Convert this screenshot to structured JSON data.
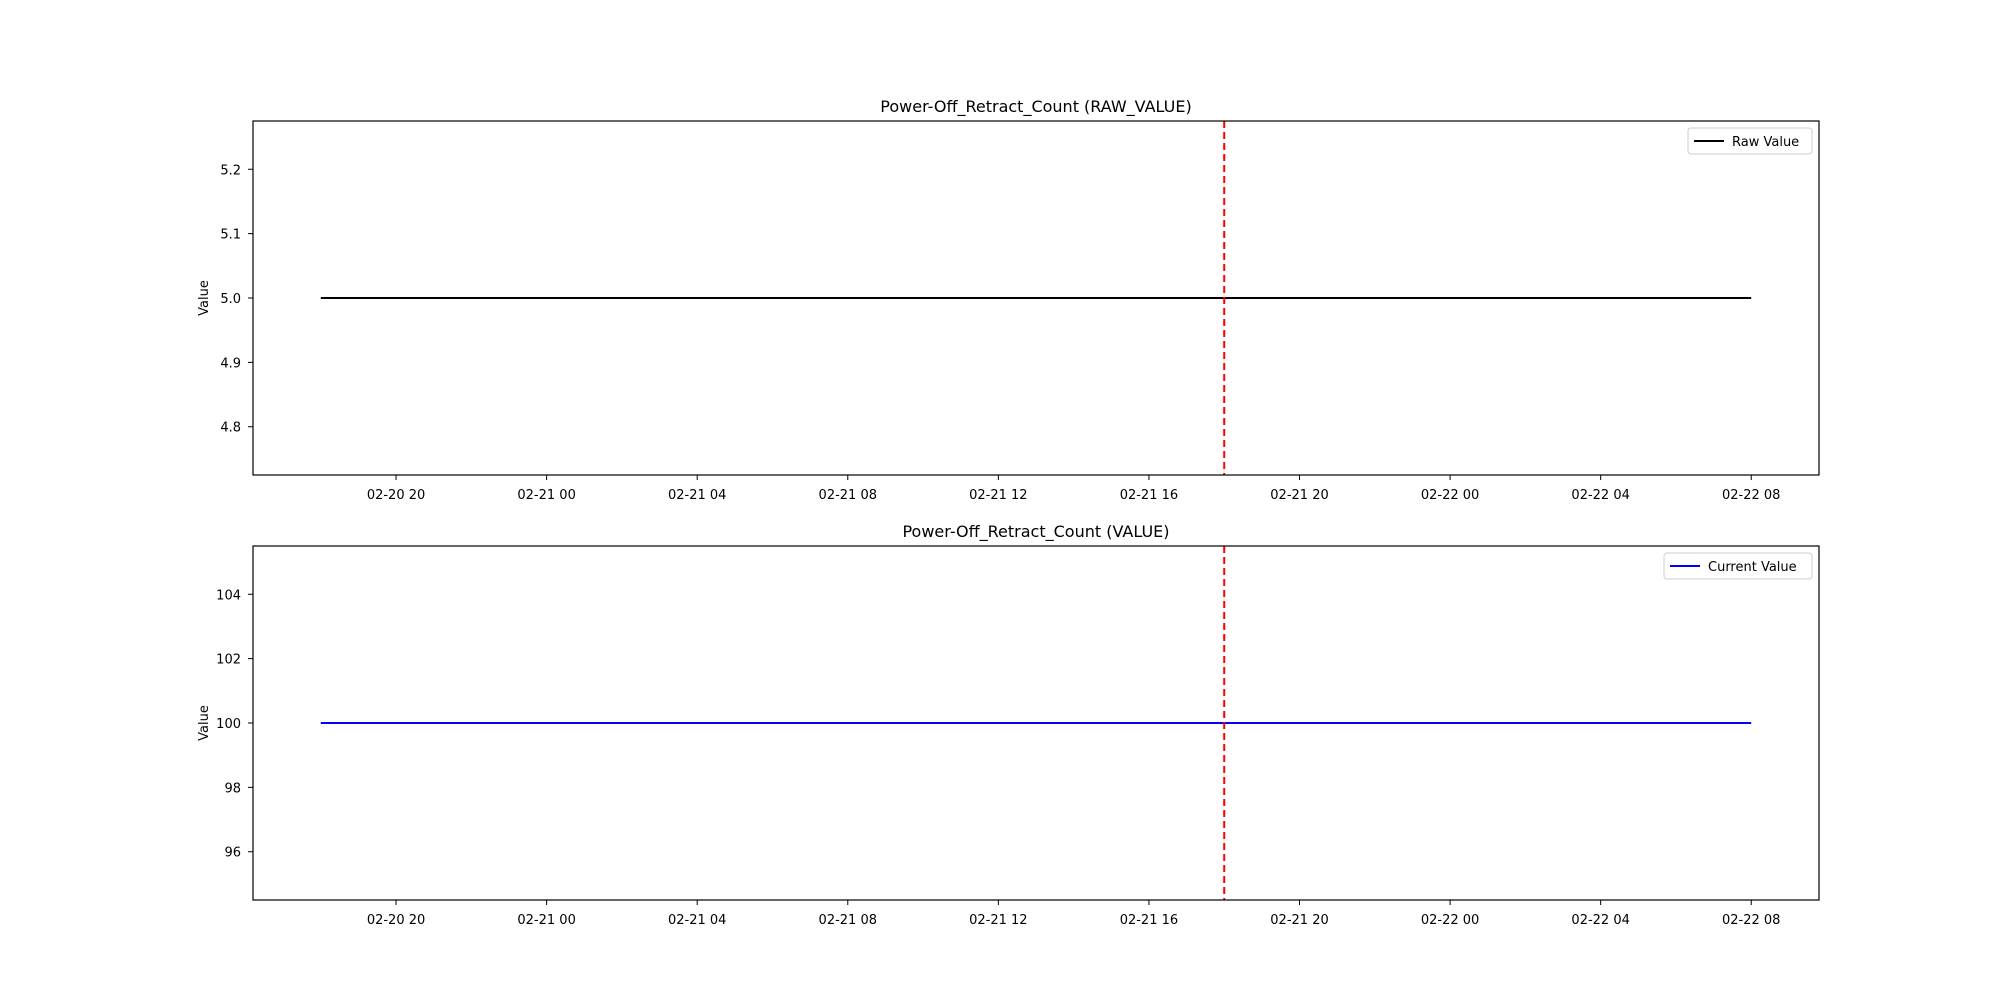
{
  "chart_data": [
    {
      "type": "line",
      "title": "Power-Off_Retract_Count (RAW_VALUE)",
      "xlabel": "",
      "ylabel": "Value",
      "x_range": [
        "2020-02-20 16:12",
        "2020-02-22 09:48"
      ],
      "xticks": [
        "02-20 20",
        "02-21 00",
        "02-21 04",
        "02-21 08",
        "02-21 12",
        "02-21 16",
        "02-21 20",
        "02-22 00",
        "02-22 04",
        "02-22 08"
      ],
      "xtick_values": [
        "2020-02-20 20:00",
        "2020-02-21 00:00",
        "2020-02-21 04:00",
        "2020-02-21 08:00",
        "2020-02-21 12:00",
        "2020-02-21 16:00",
        "2020-02-21 20:00",
        "2020-02-22 00:00",
        "2020-02-22 04:00",
        "2020-02-22 08:00"
      ],
      "ylim": [
        4.725,
        5.275
      ],
      "yticks": [
        "4.8",
        "4.9",
        "5.0",
        "5.1",
        "5.2"
      ],
      "ytick_values": [
        4.8,
        4.9,
        5.0,
        5.1,
        5.2
      ],
      "series": [
        {
          "name": "Raw Value",
          "color": "#000000",
          "x": [
            "2020-02-20 18:00",
            "2020-02-22 08:00"
          ],
          "y": [
            5,
            5
          ]
        }
      ],
      "vline": {
        "x": "2020-02-21 18:00",
        "color": "#ff0000",
        "style": "dashed"
      },
      "legend": "top-right",
      "grid": false
    },
    {
      "type": "line",
      "title": "Power-Off_Retract_Count (VALUE)",
      "xlabel": "",
      "ylabel": "Value",
      "x_range": [
        "2020-02-20 16:12",
        "2020-02-22 09:48"
      ],
      "xticks": [
        "02-20 20",
        "02-21 00",
        "02-21 04",
        "02-21 08",
        "02-21 12",
        "02-21 16",
        "02-21 20",
        "02-22 00",
        "02-22 04",
        "02-22 08"
      ],
      "xtick_values": [
        "2020-02-20 20:00",
        "2020-02-21 00:00",
        "2020-02-21 04:00",
        "2020-02-21 08:00",
        "2020-02-21 12:00",
        "2020-02-21 16:00",
        "2020-02-21 20:00",
        "2020-02-22 00:00",
        "2020-02-22 04:00",
        "2020-02-22 08:00"
      ],
      "ylim": [
        94.5,
        105.5
      ],
      "yticks": [
        "96",
        "98",
        "100",
        "102",
        "104"
      ],
      "ytick_values": [
        96,
        98,
        100,
        102,
        104
      ],
      "series": [
        {
          "name": "Current Value",
          "color": "#0000ff",
          "x": [
            "2020-02-20 18:00",
            "2020-02-22 08:00"
          ],
          "y": [
            100,
            100
          ]
        }
      ],
      "vline": {
        "x": "2020-02-21 18:00",
        "color": "#ff0000",
        "style": "dashed"
      },
      "legend": "top-right",
      "grid": false
    }
  ]
}
